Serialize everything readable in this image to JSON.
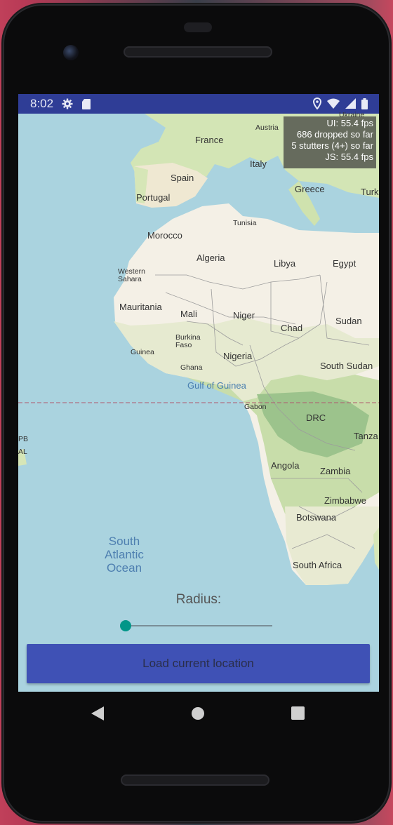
{
  "status_bar": {
    "time": "8:02",
    "left_icons": [
      "gear-icon",
      "sd-card-icon"
    ],
    "right_icons": [
      "location-pin-icon",
      "wifi-icon",
      "signal-icon",
      "battery-icon"
    ]
  },
  "perf_overlay": {
    "line1": "UI: 55.4 fps",
    "line2": "686 dropped so far",
    "line3": "5 stutters (4+) so far",
    "line4": "JS: 55.4 fps"
  },
  "map": {
    "labels": {
      "ukraine": "Ukraine",
      "austria": "Austria",
      "france": "France",
      "italy": "Italy",
      "spain": "Spain",
      "portugal": "Portugal",
      "greece": "Greece",
      "turkey": "Turk",
      "tunisia": "Tunisia",
      "morocco": "Morocco",
      "algeria": "Algeria",
      "libya": "Libya",
      "egypt": "Egypt",
      "western_sahara": "Western\nSahara",
      "mauritania": "Mauritania",
      "mali": "Mali",
      "niger": "Niger",
      "chad": "Chad",
      "sudan": "Sudan",
      "burkina_faso": "Burkina\nFaso",
      "guinea": "Guinea",
      "ghana": "Ghana",
      "nigeria": "Nigeria",
      "south_sudan": "South Sudan",
      "gulf_of_guinea": "Gulf of Guinea",
      "gabon": "Gabon",
      "drc": "DRC",
      "tanzania": "Tanza",
      "angola": "Angola",
      "zambia": "Zambia",
      "zimbabwe": "Zimbabwe",
      "botswana": "Botswana",
      "south_africa": "South Africa",
      "south_atlantic_ocean": "South\nAtlantic\nOcean",
      "pb": "PB",
      "al": "AL"
    },
    "colors": {
      "water": "#aad3df",
      "land": "#f4f0e6",
      "green": "#c9deac",
      "dark_green": "#9fc38d",
      "equator": "#b05a6e"
    }
  },
  "controls": {
    "radius_label": "Radius:",
    "slider_value": 0,
    "load_button_label": "Load current location"
  },
  "nav_bar": {
    "icons": [
      "back-icon",
      "home-icon",
      "recents-icon"
    ]
  }
}
